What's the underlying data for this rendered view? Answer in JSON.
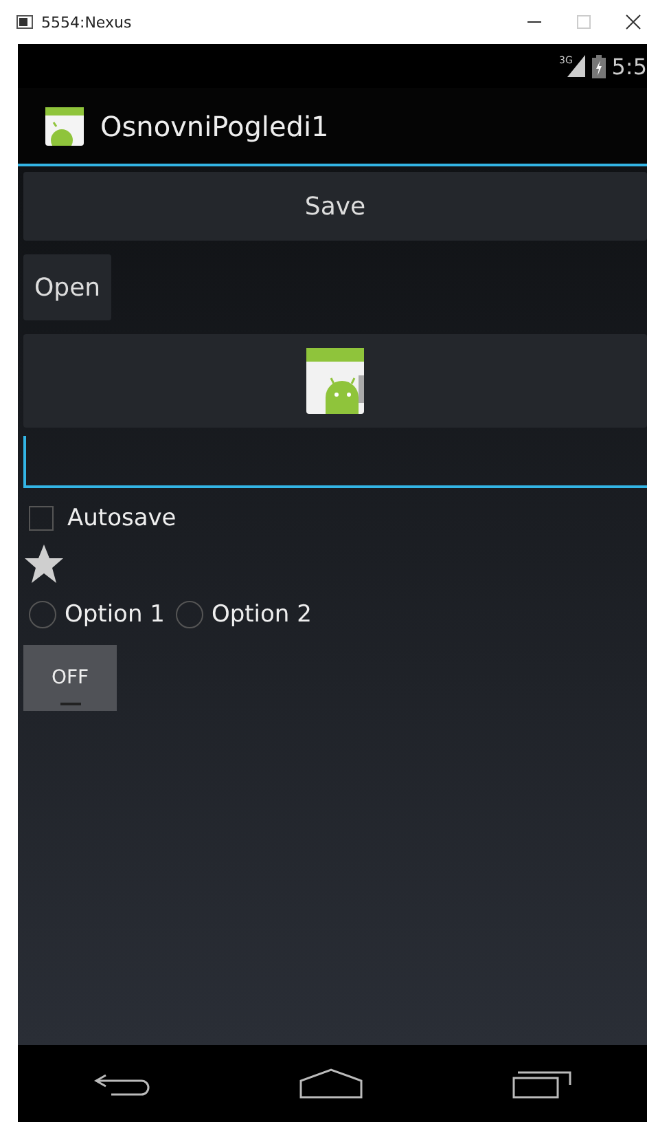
{
  "window": {
    "title": "5554:Nexus"
  },
  "status_bar": {
    "time": "5:5",
    "network": "3G"
  },
  "action_bar": {
    "title": "OsnovniPogledi1"
  },
  "buttons": [
    {
      "label": "Save"
    },
    {
      "label": "Open"
    }
  ],
  "checkbox": {
    "label": "Autosave",
    "checked": false
  },
  "star": {
    "checked": false
  },
  "radios": [
    {
      "label": "Option 1",
      "selected": false
    },
    {
      "label": "Option 2",
      "selected": false
    }
  ],
  "toggle": {
    "label": "OFF",
    "on": false
  }
}
